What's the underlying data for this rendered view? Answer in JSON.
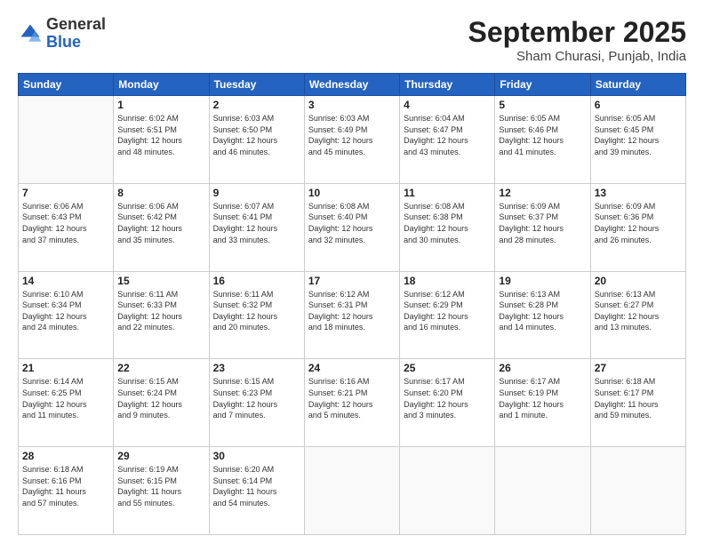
{
  "logo": {
    "general": "General",
    "blue": "Blue"
  },
  "title": {
    "month": "September 2025",
    "location": "Sham Churasi, Punjab, India"
  },
  "headers": [
    "Sunday",
    "Monday",
    "Tuesday",
    "Wednesday",
    "Thursday",
    "Friday",
    "Saturday"
  ],
  "weeks": [
    [
      {
        "day": "",
        "info": ""
      },
      {
        "day": "1",
        "info": "Sunrise: 6:02 AM\nSunset: 6:51 PM\nDaylight: 12 hours\nand 48 minutes."
      },
      {
        "day": "2",
        "info": "Sunrise: 6:03 AM\nSunset: 6:50 PM\nDaylight: 12 hours\nand 46 minutes."
      },
      {
        "day": "3",
        "info": "Sunrise: 6:03 AM\nSunset: 6:49 PM\nDaylight: 12 hours\nand 45 minutes."
      },
      {
        "day": "4",
        "info": "Sunrise: 6:04 AM\nSunset: 6:47 PM\nDaylight: 12 hours\nand 43 minutes."
      },
      {
        "day": "5",
        "info": "Sunrise: 6:05 AM\nSunset: 6:46 PM\nDaylight: 12 hours\nand 41 minutes."
      },
      {
        "day": "6",
        "info": "Sunrise: 6:05 AM\nSunset: 6:45 PM\nDaylight: 12 hours\nand 39 minutes."
      }
    ],
    [
      {
        "day": "7",
        "info": "Sunrise: 6:06 AM\nSunset: 6:43 PM\nDaylight: 12 hours\nand 37 minutes."
      },
      {
        "day": "8",
        "info": "Sunrise: 6:06 AM\nSunset: 6:42 PM\nDaylight: 12 hours\nand 35 minutes."
      },
      {
        "day": "9",
        "info": "Sunrise: 6:07 AM\nSunset: 6:41 PM\nDaylight: 12 hours\nand 33 minutes."
      },
      {
        "day": "10",
        "info": "Sunrise: 6:08 AM\nSunset: 6:40 PM\nDaylight: 12 hours\nand 32 minutes."
      },
      {
        "day": "11",
        "info": "Sunrise: 6:08 AM\nSunset: 6:38 PM\nDaylight: 12 hours\nand 30 minutes."
      },
      {
        "day": "12",
        "info": "Sunrise: 6:09 AM\nSunset: 6:37 PM\nDaylight: 12 hours\nand 28 minutes."
      },
      {
        "day": "13",
        "info": "Sunrise: 6:09 AM\nSunset: 6:36 PM\nDaylight: 12 hours\nand 26 minutes."
      }
    ],
    [
      {
        "day": "14",
        "info": "Sunrise: 6:10 AM\nSunset: 6:34 PM\nDaylight: 12 hours\nand 24 minutes."
      },
      {
        "day": "15",
        "info": "Sunrise: 6:11 AM\nSunset: 6:33 PM\nDaylight: 12 hours\nand 22 minutes."
      },
      {
        "day": "16",
        "info": "Sunrise: 6:11 AM\nSunset: 6:32 PM\nDaylight: 12 hours\nand 20 minutes."
      },
      {
        "day": "17",
        "info": "Sunrise: 6:12 AM\nSunset: 6:31 PM\nDaylight: 12 hours\nand 18 minutes."
      },
      {
        "day": "18",
        "info": "Sunrise: 6:12 AM\nSunset: 6:29 PM\nDaylight: 12 hours\nand 16 minutes."
      },
      {
        "day": "19",
        "info": "Sunrise: 6:13 AM\nSunset: 6:28 PM\nDaylight: 12 hours\nand 14 minutes."
      },
      {
        "day": "20",
        "info": "Sunrise: 6:13 AM\nSunset: 6:27 PM\nDaylight: 12 hours\nand 13 minutes."
      }
    ],
    [
      {
        "day": "21",
        "info": "Sunrise: 6:14 AM\nSunset: 6:25 PM\nDaylight: 12 hours\nand 11 minutes."
      },
      {
        "day": "22",
        "info": "Sunrise: 6:15 AM\nSunset: 6:24 PM\nDaylight: 12 hours\nand 9 minutes."
      },
      {
        "day": "23",
        "info": "Sunrise: 6:15 AM\nSunset: 6:23 PM\nDaylight: 12 hours\nand 7 minutes."
      },
      {
        "day": "24",
        "info": "Sunrise: 6:16 AM\nSunset: 6:21 PM\nDaylight: 12 hours\nand 5 minutes."
      },
      {
        "day": "25",
        "info": "Sunrise: 6:17 AM\nSunset: 6:20 PM\nDaylight: 12 hours\nand 3 minutes."
      },
      {
        "day": "26",
        "info": "Sunrise: 6:17 AM\nSunset: 6:19 PM\nDaylight: 12 hours\nand 1 minute."
      },
      {
        "day": "27",
        "info": "Sunrise: 6:18 AM\nSunset: 6:17 PM\nDaylight: 11 hours\nand 59 minutes."
      }
    ],
    [
      {
        "day": "28",
        "info": "Sunrise: 6:18 AM\nSunset: 6:16 PM\nDaylight: 11 hours\nand 57 minutes."
      },
      {
        "day": "29",
        "info": "Sunrise: 6:19 AM\nSunset: 6:15 PM\nDaylight: 11 hours\nand 55 minutes."
      },
      {
        "day": "30",
        "info": "Sunrise: 6:20 AM\nSunset: 6:14 PM\nDaylight: 11 hours\nand 54 minutes."
      },
      {
        "day": "",
        "info": ""
      },
      {
        "day": "",
        "info": ""
      },
      {
        "day": "",
        "info": ""
      },
      {
        "day": "",
        "info": ""
      }
    ]
  ]
}
